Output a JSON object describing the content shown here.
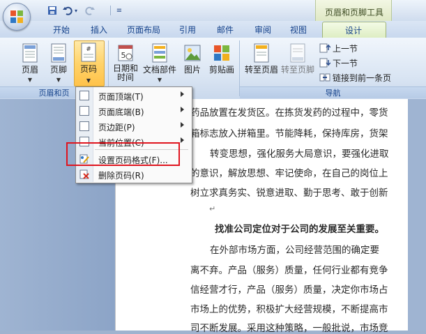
{
  "qat": {
    "save_icon": "save-icon",
    "undo_icon": "undo-icon",
    "redo_icon": "redo-icon",
    "customize_icon": "customize-icon"
  },
  "tools_title": "页眉和页脚工具",
  "tabs": [
    "开始",
    "插入",
    "页面布局",
    "引用",
    "邮件",
    "审阅",
    "视图"
  ],
  "active_tab": "设计",
  "ribbon": {
    "header": "页眉",
    "footer": "页脚",
    "page_number": "页码",
    "datetime_line1": "日期和",
    "datetime_line2": "时间",
    "doc_parts": "文档部件",
    "picture": "图片",
    "clipart": "剪贴画",
    "goto_header": "转至页眉",
    "goto_footer": "转至页脚",
    "prev_section": "上一节",
    "next_section": "下一节",
    "link_prev": "链接到前一条页",
    "group_header_footer": "页眉和页",
    "group_nav": "导航"
  },
  "menu": {
    "items": [
      {
        "label": "页面顶端(T)",
        "submenu": true
      },
      {
        "label": "页面底端(B)",
        "submenu": true
      },
      {
        "label": "页边距(P)",
        "submenu": true
      },
      {
        "label": "当前位置(C)",
        "submenu": true
      },
      {
        "label": "设置页码格式(F)...",
        "submenu": false
      },
      {
        "label": "删除页码(R)",
        "submenu": false
      }
    ]
  },
  "doc": {
    "lines": [
      "药品放置在发货区。在拣货发药的过程中，零货",
      "箱标志放入拼箱里。节能降耗，保持库房，货架",
      "转变思想，强化服务大局意识，要强化进取",
      "的意识，解放思想、牢记使命，在自己的岗位上",
      "树立求真务实、锐意进取、勤于思考、敢于创新",
      "找准公司定位对于公司的发展至关重要。",
      "在外部市场方面，公司经营范围的确定要",
      "离不弃。产品（服务）质量，任何行业都有竞争",
      "信经营才行，产品（服务）质量，决定你市场占",
      "市场上的优势，积极扩大经营规模，不断提高市",
      "司不断发展。采用这种策略，一般批说，市场竞"
    ],
    "paragraph_mark": "↵"
  },
  "colors": {
    "highlight_box": "#e0141e",
    "active_tab": "#dcecc0",
    "ribbon_text": "#15428b"
  }
}
